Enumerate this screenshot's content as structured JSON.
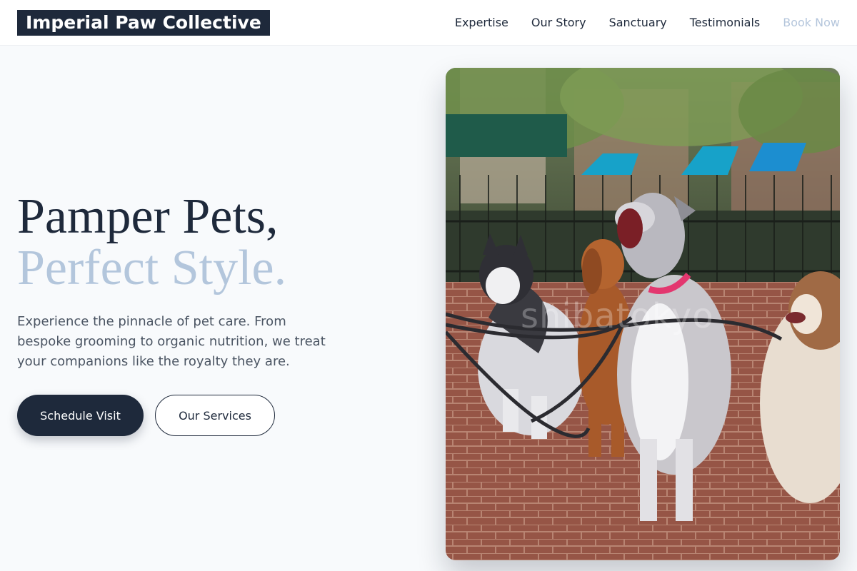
{
  "header": {
    "brand": "Imperial Paw Collective",
    "nav": [
      {
        "label": "Expertise"
      },
      {
        "label": "Our Story"
      },
      {
        "label": "Sanctuary"
      },
      {
        "label": "Testimonials"
      },
      {
        "label": "Book Now"
      }
    ]
  },
  "hero": {
    "title_line1": "Pamper Pets,",
    "title_line2": "Perfect Style.",
    "subtitle": "Experience the pinnacle of pet care. From bespoke grooming to organic nutrition, we treat your companions like the royalty they are.",
    "primary_button": "Schedule Visit",
    "secondary_button": "Our Services"
  },
  "image": {
    "subject": "four-dogs-on-leashes-in-park",
    "watermark": "shibatokyo"
  },
  "colors": {
    "navy": "#1e293b",
    "accent_blue": "#b3c6dc",
    "background": "#f8fafc"
  }
}
